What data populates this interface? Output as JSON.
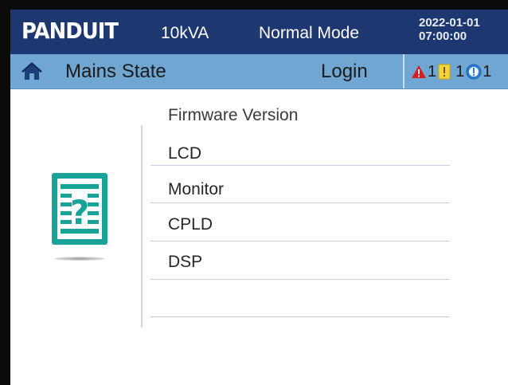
{
  "header": {
    "brand": "PANDUIT",
    "rating": "10kVA",
    "mode": "Normal Mode",
    "date": "2022-01-01",
    "time": "07:00:00"
  },
  "status_bar": {
    "home_icon": "home-icon",
    "state": "Mains State",
    "login": "Login",
    "alarms": [
      {
        "icon": "critical-alarm-icon",
        "count": "1",
        "color": "#d81e1e"
      },
      {
        "icon": "warning-alarm-icon",
        "count": "1",
        "color": "#f2d43a"
      },
      {
        "icon": "info-alarm-icon",
        "count": "1",
        "color": "#2b7fd6"
      }
    ]
  },
  "main": {
    "icon": "help-document-icon",
    "section_title": "Firmware Version",
    "items": [
      "LCD",
      "Monitor",
      "CPLD",
      "DSP"
    ]
  },
  "colors": {
    "header_bg": "#1d3870",
    "status_bg": "#6fa6d2",
    "icon_teal": "#17a398"
  }
}
